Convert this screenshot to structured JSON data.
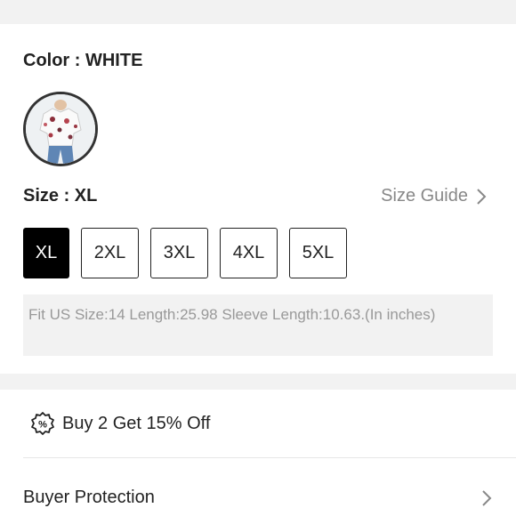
{
  "color": {
    "title": "Color : WHITE",
    "swatch_icon": "floral-blouse-thumbnail"
  },
  "size": {
    "title": "Size : XL",
    "guide_label": "Size Guide",
    "options": [
      "XL",
      "2XL",
      "3XL",
      "4XL",
      "5XL"
    ],
    "selected": "XL",
    "fit_info": "Fit US Size:14   Length:25.98   Sleeve Length:10.63.(In inches)"
  },
  "promo": {
    "icon": "percent-badge-icon",
    "label": "Buy 2 Get 15% Off"
  },
  "buyer_protection": {
    "label": "Buyer Protection",
    "icon": "chevron-right-icon"
  },
  "colors": {
    "selected_bg": "#000000",
    "muted_text": "#888888",
    "info_bg": "#f2f2f2"
  }
}
